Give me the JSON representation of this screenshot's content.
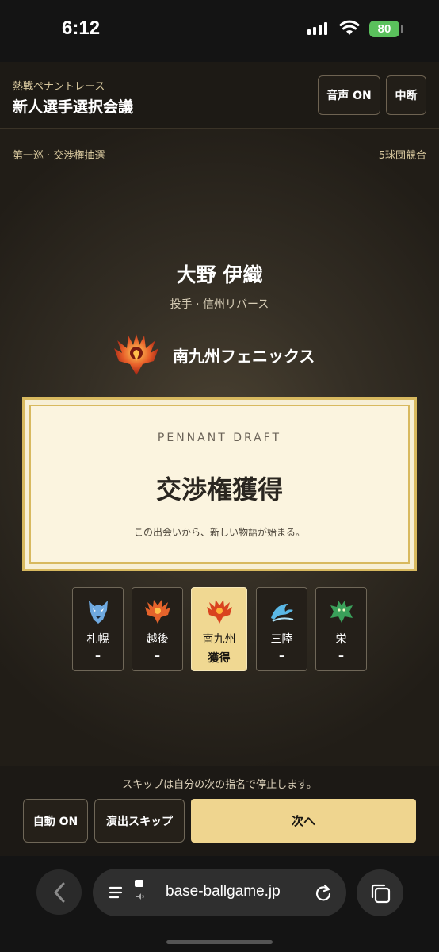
{
  "status_bar": {
    "time": "6:12",
    "battery": "80"
  },
  "header": {
    "subtitle": "熱戦ペナントレース",
    "title": "新人選手選択会議",
    "sound_button": "音声 ON",
    "pause_button": "中断"
  },
  "stage": {
    "round_label": "第一巡 · 交渉権抽選",
    "compete_label": "5球団競合",
    "player_name": "大野 伊織",
    "player_info": "投手 · 信州リバース",
    "winning_team": "南九州フェニックス"
  },
  "card": {
    "eyebrow": "PENNANT DRAFT",
    "headline": "交渉権獲得",
    "caption": "この出会いから、新しい物語が始まる。"
  },
  "teams": [
    {
      "name": "札幌",
      "status": "–",
      "icon": "wolf-icon",
      "color": "#6fa9e0"
    },
    {
      "name": "越後",
      "status": "–",
      "icon": "phoenix-icon",
      "color": "#e5632b"
    },
    {
      "name": "南九州",
      "status": "獲得",
      "icon": "phoenix-icon",
      "color": "#d9431f"
    },
    {
      "name": "三陸",
      "status": "–",
      "icon": "wave-icon",
      "color": "#5ab8e6"
    },
    {
      "name": "栄",
      "status": "–",
      "icon": "dragon-icon",
      "color": "#3aa05a"
    }
  ],
  "bottom": {
    "skip_note": "スキップは自分の次の指名で停止します。",
    "auto_button": "自動 ON",
    "skip_button": "演出スキップ",
    "next_button": "次へ"
  },
  "browser": {
    "url": "base-ballgame.jp"
  },
  "colors": {
    "accent": "#efd58f",
    "frame": "#d8b95f",
    "background": "#1b1813"
  }
}
